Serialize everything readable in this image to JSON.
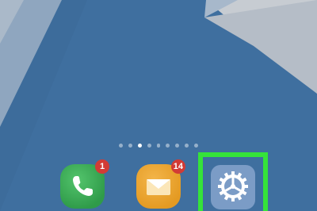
{
  "home_screen": {
    "page_indicator": {
      "count": 9,
      "active_index": 2
    },
    "dock": {
      "apps": [
        {
          "name": "phone",
          "icon": "phone-icon",
          "badge": "1",
          "color": "#2f9b49"
        },
        {
          "name": "email",
          "icon": "envelope-icon",
          "badge": "14",
          "color": "#e49a22"
        },
        {
          "name": "settings",
          "icon": "gear-icon",
          "badge": "",
          "color": "#7b9cc6"
        }
      ]
    },
    "highlight": {
      "target": "settings",
      "color": "#35e33a"
    }
  }
}
